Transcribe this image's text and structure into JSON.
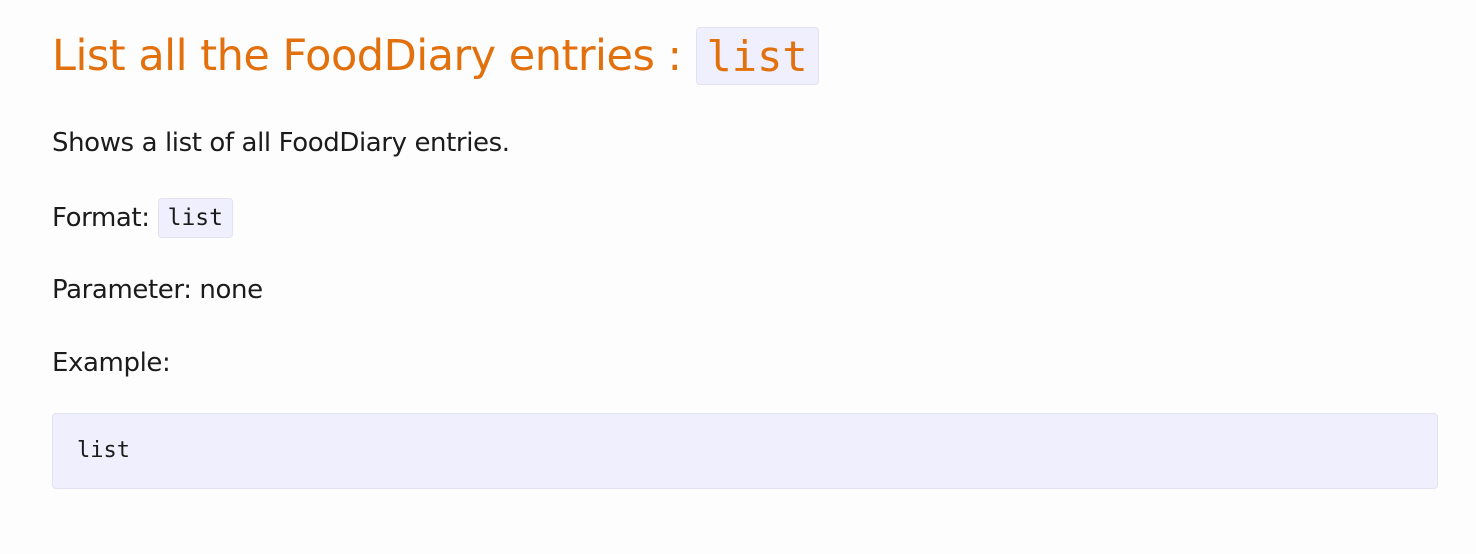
{
  "section": {
    "title_text": "List all the FoodDiary entries :",
    "title_command": "list",
    "description": "Shows a list of all FoodDiary entries.",
    "format_label": "Format:",
    "format_command": "list",
    "parameter_text": "Parameter: none",
    "example_label": "Example:",
    "example_code": "list"
  },
  "colors": {
    "heading": "#e2700d",
    "code_background": "#efeffd",
    "page_background": "#fdfdfd",
    "text": "#1b1b1b"
  }
}
